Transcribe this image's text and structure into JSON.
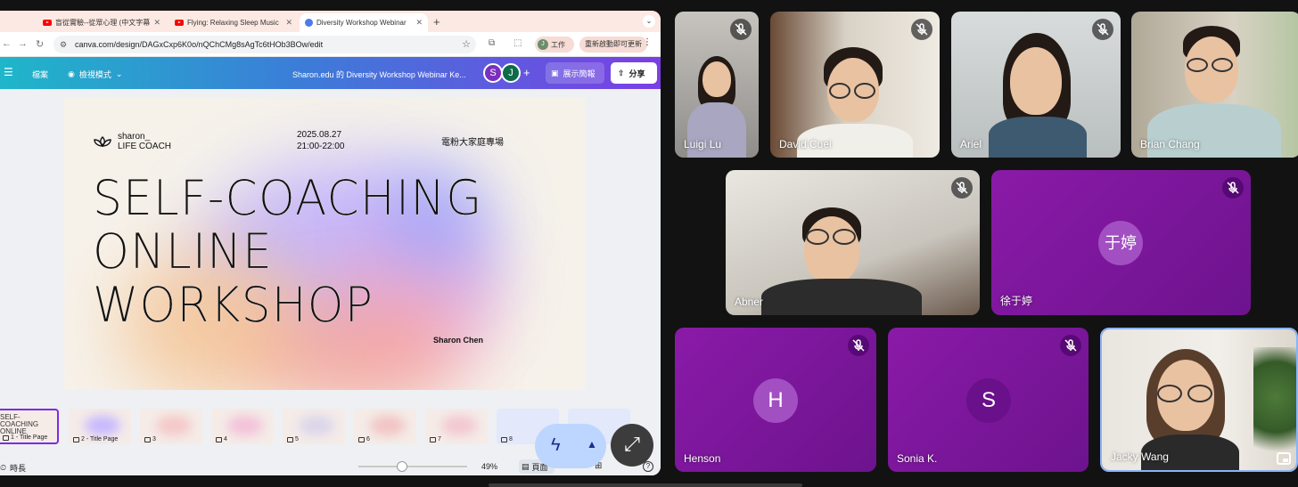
{
  "browser": {
    "tabs": [
      {
        "title": "盲從實驗--從眾心理 (中文字幕",
        "icon": "youtube-icon"
      },
      {
        "title": "Flying: Relaxing Sleep Music",
        "icon": "youtube-icon"
      },
      {
        "title": "Diversity Workshop Webinar",
        "icon": "canva-icon",
        "active": true
      }
    ],
    "url": "canva.com/design/DAGxCxp6K0o/nQChCMg8sAgTc6tHOb3BOw/edit",
    "profile_label": "工作",
    "profile_initial": "J",
    "update_label": "重新啟動即可更新"
  },
  "canva": {
    "menu_file": "檔案",
    "view_mode": "檢視模式",
    "doc_title": "Sharon.edu 的 Diversity Workshop Webinar Ke...",
    "collaborators": [
      "S",
      "J"
    ],
    "present_label": "展示簡報",
    "share_label": "分享",
    "slide": {
      "brand_line1": "sharon_",
      "brand_line2": "LIFE COACH",
      "date": "2025.08.27",
      "time": "21:00-22:00",
      "event": "電粉大家庭專場",
      "title_line1": "SELF-COACHING",
      "title_line2": "ONLINE",
      "title_line3": "WORKSHOP",
      "presenter": "Sharon Chen"
    },
    "thumbnails": [
      {
        "label": "1 - Title Page",
        "preview": "SELF-COACHING ONLINE"
      },
      {
        "label": "2 - Title Page"
      },
      {
        "label": "3"
      },
      {
        "label": "4"
      },
      {
        "label": "5"
      },
      {
        "label": "6"
      },
      {
        "label": "7"
      },
      {
        "label": "8"
      }
    ],
    "timer_label": "時長",
    "zoom": "49%",
    "zoom_fraction": 0.4,
    "pages_label": "頁面"
  },
  "meet": {
    "participants": [
      {
        "name": "Luigi Lu",
        "muted": true,
        "video": true
      },
      {
        "name": "David Cuei",
        "muted": true,
        "video": true
      },
      {
        "name": "Ariel",
        "muted": true,
        "video": true
      },
      {
        "name": "Brian Chang",
        "muted": true,
        "video": true
      },
      {
        "name": "Abner",
        "muted": true,
        "video": true
      },
      {
        "name": "徐于婷",
        "muted": true,
        "video": false,
        "avatar": "于婷"
      },
      {
        "name": "Henson",
        "muted": true,
        "video": false,
        "avatar": "H"
      },
      {
        "name": "Sonia K.",
        "muted": true,
        "video": false,
        "avatar": "S"
      },
      {
        "name": "Jacky Wang",
        "muted": false,
        "video": true
      }
    ]
  },
  "colors": {
    "meet_tile_purple": "#7b179c",
    "canva_gradient_start": "#1fb6c9",
    "canva_gradient_end": "#7b3fe4",
    "active_speaker_border": "#8ab4f8"
  }
}
